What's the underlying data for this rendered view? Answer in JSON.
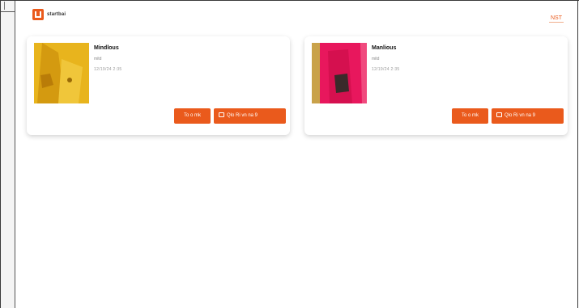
{
  "header": {
    "logo_text": "startbai",
    "top_link": "NST"
  },
  "cards": [
    {
      "name": "Mindlous",
      "meta1": "mitd",
      "meta2": "12/19/24 2:35",
      "btn_small": "To o mk",
      "btn_wide": "Qlo Ri vn na 9",
      "image_color": "#e8b41d"
    },
    {
      "name": "Manlious",
      "meta1": "mitd",
      "meta2": "12/19/24 2:35",
      "btn_small": "To o mk",
      "btn_wide": "Qlo Ri vn na 9",
      "image_color": "#e8175d"
    }
  ],
  "colors": {
    "accent": "#ea5a1c"
  }
}
